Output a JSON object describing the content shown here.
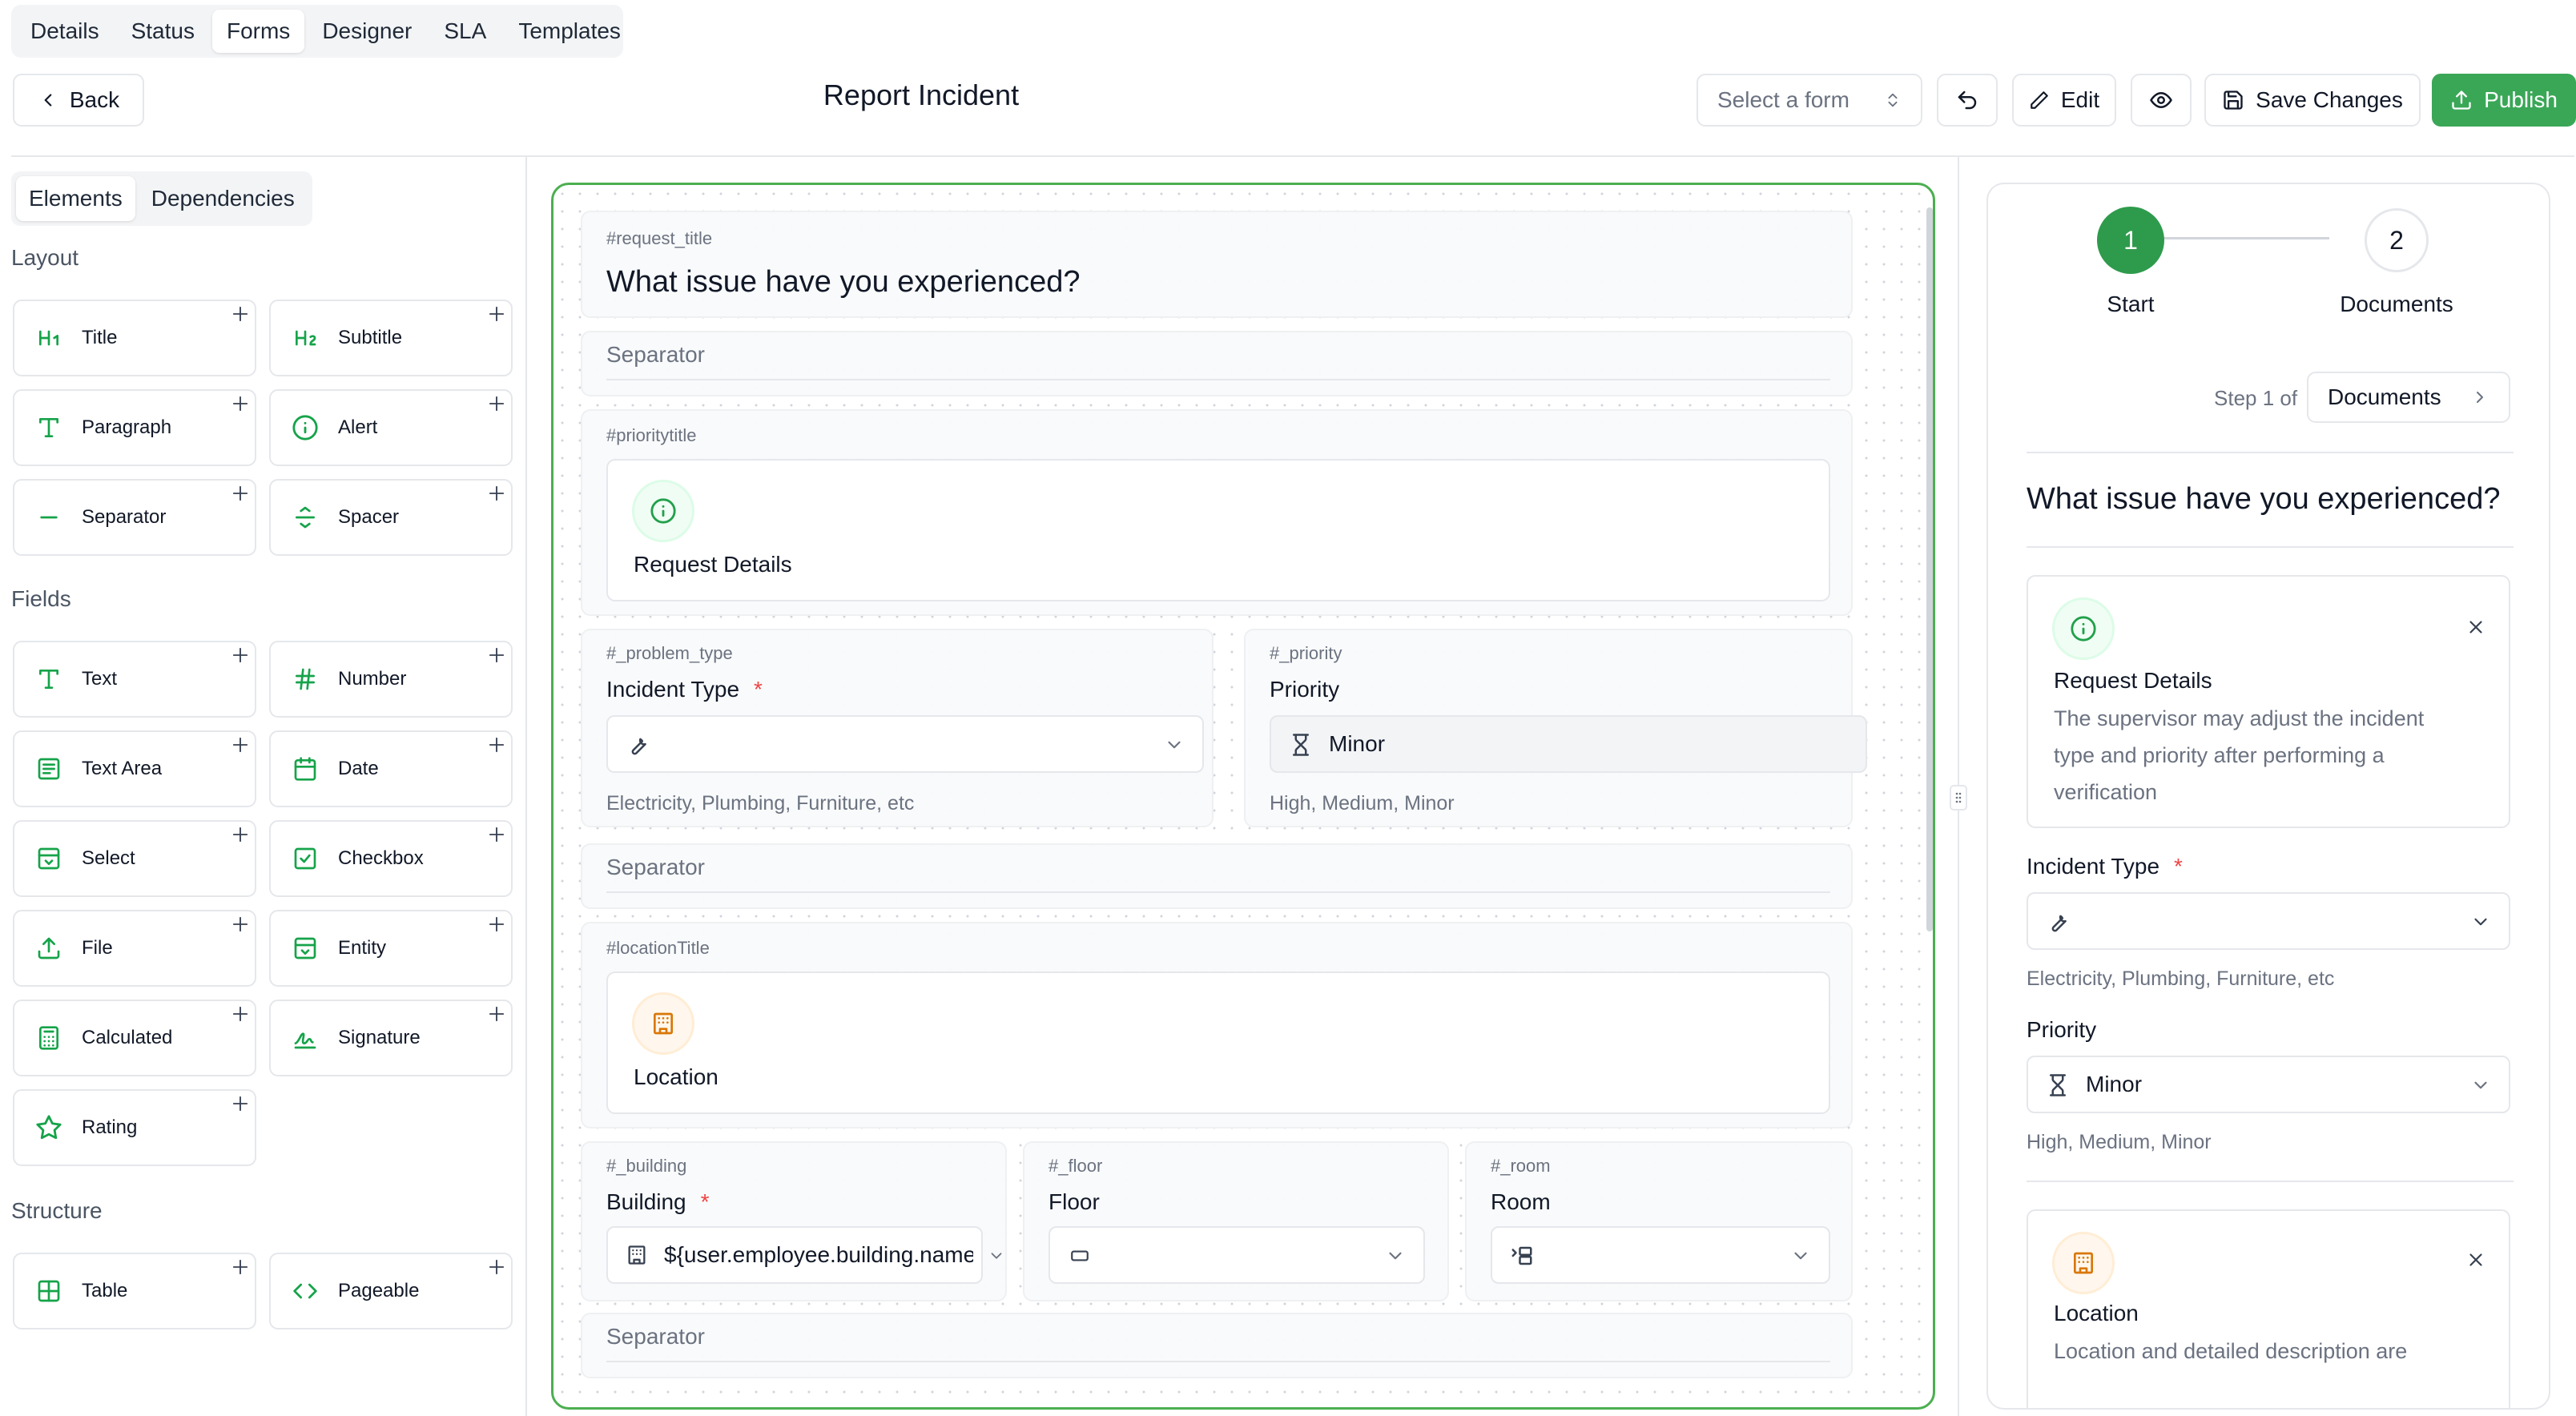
{
  "top_tabs": [
    "Details",
    "Status",
    "Forms",
    "Designer",
    "SLA",
    "Templates"
  ],
  "toolbar": {
    "back_label": "Back",
    "title": "Report Incident",
    "select_form_placeholder": "Select a form",
    "edit_label": "Edit",
    "save_label": "Save Changes",
    "publish_label": "Publish"
  },
  "left_tabs": [
    "Elements",
    "Dependencies"
  ],
  "sections": {
    "layout": "Layout",
    "fields": "Fields",
    "structure": "Structure"
  },
  "layout_items": [
    {
      "label": "Title",
      "icon": "heading-1-icon"
    },
    {
      "label": "Subtitle",
      "icon": "heading-2-icon"
    },
    {
      "label": "Paragraph",
      "icon": "type-icon"
    },
    {
      "label": "Alert",
      "icon": "info-icon"
    },
    {
      "label": "Separator",
      "icon": "minus-icon"
    },
    {
      "label": "Spacer",
      "icon": "spacer-icon"
    }
  ],
  "field_items": [
    {
      "label": "Text",
      "icon": "type-icon"
    },
    {
      "label": "Number",
      "icon": "hash-icon"
    },
    {
      "label": "Text Area",
      "icon": "text-area-icon"
    },
    {
      "label": "Date",
      "icon": "calendar-icon"
    },
    {
      "label": "Select",
      "icon": "select-icon"
    },
    {
      "label": "Checkbox",
      "icon": "checkbox-icon"
    },
    {
      "label": "File",
      "icon": "upload-icon"
    },
    {
      "label": "Entity",
      "icon": "entity-icon"
    },
    {
      "label": "Calculated",
      "icon": "calculator-icon"
    },
    {
      "label": "Signature",
      "icon": "signature-icon"
    },
    {
      "label": "Rating",
      "icon": "star-icon"
    }
  ],
  "structure_items": [
    {
      "label": "Table",
      "icon": "table-icon"
    },
    {
      "label": "Pageable",
      "icon": "code-icon"
    }
  ],
  "canvas": {
    "request_title_tag": "#request_title",
    "request_title": "What issue have you experienced?",
    "separator_label": "Separator",
    "priority_title_tag": "#prioritytitle",
    "priority_title": "Request Details",
    "problem_type_tag": "#_problem_type",
    "problem_type_label": "Incident Type",
    "problem_type_hint": "Electricity, Plumbing, Furniture, etc",
    "priority_tag": "#_priority",
    "priority_label": "Priority",
    "priority_value": "Minor",
    "priority_hint": "High, Medium, Minor",
    "location_title_tag": "#locationTitle",
    "location_title": "Location",
    "building_tag": "#_building",
    "building_label": "Building",
    "building_value": "${user.employee.building.name}",
    "floor_tag": "#_floor",
    "floor_label": "Floor",
    "room_tag": "#_room",
    "room_label": "Room",
    "required_mark": "*"
  },
  "preview": {
    "steps": [
      {
        "number": "1",
        "label": "Start"
      },
      {
        "number": "2",
        "label": "Documents"
      }
    ],
    "step_prefix": "Step 1 of",
    "step_select": "Documents",
    "heading": "What issue have you experienced?",
    "details_title": "Request Details",
    "details_text": "The supervisor may adjust the incident type and priority after performing a verification",
    "incident_label": "Incident Type",
    "incident_hint": "Electricity, Plumbing, Furniture, etc",
    "priority_label": "Priority",
    "priority_value": "Minor",
    "priority_hint": "High, Medium, Minor",
    "location_title": "Location",
    "location_text": "Location and detailed description are"
  },
  "colors": {
    "accent": "#22a04b",
    "publish": "#3aa757",
    "step_active": "#2e9b4c",
    "location_icon": "#d97706"
  }
}
